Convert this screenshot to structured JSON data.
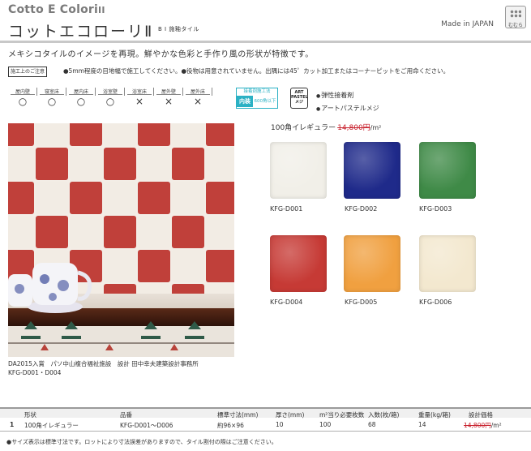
{
  "header": {
    "series_title": "Cotto E Colori",
    "series_roman": "II",
    "jp_title": "コットエコローリⅡ",
    "jp_subtitle": "B I 施釉タイル",
    "made_in": "Made in JAPAN",
    "badge_label": "むむら"
  },
  "description": "メキシコタイルのイメージを再現。鮮やかな色彩と手作り風の形状が特徴です。",
  "caution": {
    "badge": "施工上のご注意",
    "text": "●5mm程度の目地幅で施工してください。●役物は用意されていません。出隅には45゜カット加工またはコーナーピットをご用命ください。"
  },
  "usage": [
    {
      "label": "屋内壁",
      "mark": "○"
    },
    {
      "label": "寝室床",
      "mark": "○"
    },
    {
      "label": "屋内床",
      "mark": "○"
    },
    {
      "label": "浴室壁",
      "mark": "○"
    },
    {
      "label": "浴室床",
      "mark": "×"
    },
    {
      "label": "屋外壁",
      "mark": "×"
    },
    {
      "label": "屋外床",
      "mark": "×"
    }
  ],
  "method_badge": {
    "top": "接着剤施工法",
    "inner": "内装",
    "sub": "600角以下"
  },
  "art_badge": [
    "ART",
    "PASTEL",
    "メジ"
  ],
  "properties": [
    "弾性接着剤",
    "アートパステルメジ"
  ],
  "photo_caption": {
    "line1": "DA2015入賞　パソ中山複合福祉施設　設計 田中幸夫建築設計事務所",
    "line2": "KFG-D001・D004"
  },
  "product": {
    "name": "100角イレギュラー",
    "price": "14,800円",
    "unit": "/m²"
  },
  "swatches": [
    {
      "code": "KFG-D001",
      "color": "#f1efe8"
    },
    {
      "code": "KFG-D002",
      "color": "#1f2a8a"
    },
    {
      "code": "KFG-D003",
      "color": "#3f8a47"
    },
    {
      "code": "KFG-D004",
      "color": "#c63a35"
    },
    {
      "code": "KFG-D005",
      "color": "#f0a040"
    },
    {
      "code": "KFG-D006",
      "color": "#f3e8cf"
    }
  ],
  "table": {
    "headers": [
      "形状",
      "品番",
      "標準寸法(mm)",
      "厚さ(mm)",
      "m²当り必要枚数",
      "入数(枚/箱)",
      "重量(kg/箱)",
      "設計価格"
    ],
    "rows": [
      {
        "no": "1",
        "shape": "100角イレギュラー",
        "code": "KFG-D001～D006",
        "size": "約96×96",
        "thickness": "10",
        "per_m2": "100",
        "per_box": "68",
        "weight": "14",
        "price": "14,800円",
        "unit": "/m²"
      }
    ]
  },
  "footnote": "●サイズ表示は標準寸法です。ロットにより寸法誤差がありますので、タイル割付の際はご注意ください。"
}
